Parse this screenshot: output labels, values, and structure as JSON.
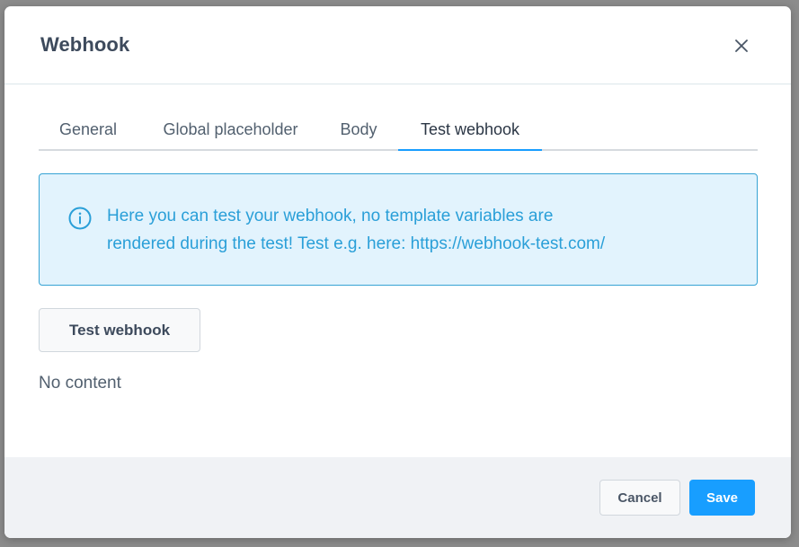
{
  "modal": {
    "title": "Webhook",
    "close_icon": "close-icon"
  },
  "tabs": [
    {
      "label": "General",
      "active": false
    },
    {
      "label": "Global placeholder",
      "active": false
    },
    {
      "label": "Body",
      "active": false
    },
    {
      "label": "Test webhook",
      "active": true
    }
  ],
  "info": {
    "icon": "info-icon",
    "line1": "Here you can test your webhook, no template variables are",
    "line2": "rendered during the test! Test e.g. here: https://webhook-test.com/"
  },
  "test_button_label": "Test webhook",
  "result_text": "No content",
  "footer": {
    "cancel_label": "Cancel",
    "save_label": "Save"
  },
  "colors": {
    "accent": "#189eff",
    "info_text": "#2a9fd8",
    "info_bg": "#e2f3fd"
  }
}
